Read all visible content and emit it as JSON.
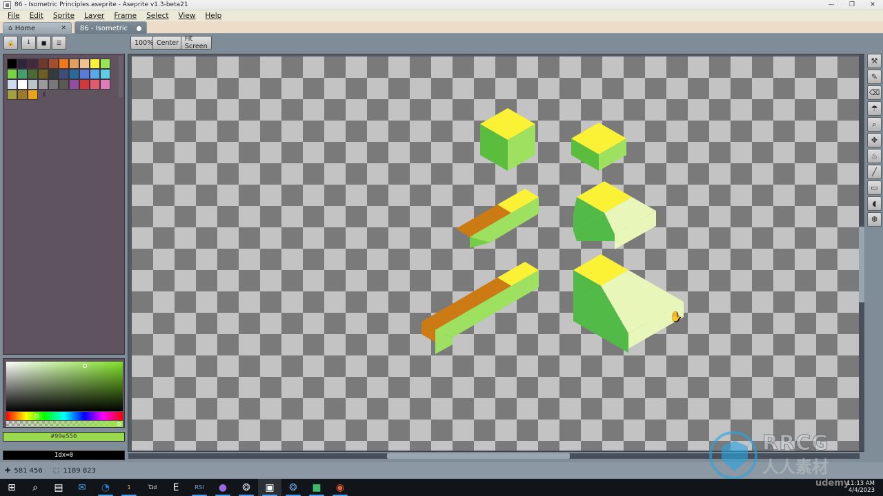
{
  "window": {
    "title": "86 - Isometric Principles.aseprite - Aseprite v1.3-beta21",
    "minimize_label": "—",
    "maximize_label": "❐",
    "close_label": "✕"
  },
  "menubar": {
    "items": [
      {
        "label": "File"
      },
      {
        "label": "Edit"
      },
      {
        "label": "Sprite"
      },
      {
        "label": "Layer"
      },
      {
        "label": "Frame"
      },
      {
        "label": "Select"
      },
      {
        "label": "View"
      },
      {
        "label": "Help"
      }
    ]
  },
  "tabs": [
    {
      "label": "Home",
      "icon": "home-icon",
      "close_label": "✕",
      "active": false
    },
    {
      "label": "86 - Isometric",
      "icon": "modified-dot",
      "active": true
    }
  ],
  "toolbar": {
    "lock_label": "🔒",
    "download_label": "↓",
    "square_label": "■",
    "menu_label": "☰",
    "zoom_label": "100%",
    "center_label": "Center",
    "fit_screen_label": "Fit Screen"
  },
  "palette": {
    "row1": [
      "#000000",
      "#2e2638",
      "#44293a",
      "#6f3a2c",
      "#a5502a",
      "#f07818",
      "#e0a060",
      "#eec392",
      "#fbf236",
      "#99e550"
    ],
    "row2": [
      "#77d442",
      "#44a06a",
      "#4a6b32",
      "#6b6020",
      "#353b38",
      "#3f4d7a",
      "#2a6a96",
      "#5b7ad8",
      "#5aa8ea",
      "#5fcde4"
    ],
    "row3": [
      "#cfdcef",
      "#ffffff",
      "#b9c6c8",
      "#9a9a9a",
      "#787878",
      "#5a5a52",
      "#8f4fa0",
      "#d43838",
      "#e35a6d",
      "#e07ab8"
    ],
    "row4": [
      "#a5a040",
      "#9b7a2a",
      "#e8a317"
    ],
    "marker": "II"
  },
  "colorpicker": {
    "hex_value": "#99e550",
    "index_value": "Idx=0",
    "accent": "#99e550"
  },
  "tools": [
    {
      "name": "magic-wand-icon",
      "glyph": "⚒",
      "selected": false
    },
    {
      "name": "pencil-icon",
      "glyph": "✎",
      "selected": false
    },
    {
      "name": "eraser-icon",
      "glyph": "⌫",
      "selected": false
    },
    {
      "name": "eyedropper-icon",
      "glyph": "☂",
      "selected": false
    },
    {
      "name": "zoom-icon",
      "glyph": "⌕",
      "selected": false
    },
    {
      "name": "move-icon",
      "glyph": "✥",
      "selected": false
    },
    {
      "name": "paint-bucket-icon",
      "glyph": "♨",
      "selected": false
    },
    {
      "name": "line-icon",
      "glyph": "╱",
      "selected": false
    },
    {
      "name": "rectangle-icon",
      "glyph": "▭",
      "selected": false
    },
    {
      "name": "contour-icon",
      "glyph": "◖",
      "selected": false
    },
    {
      "name": "spray-icon",
      "glyph": "❆",
      "selected": false
    }
  ],
  "statusbar": {
    "cursor_icon": "✚",
    "cursor_pos": "581 456",
    "size_icon": "⬚",
    "sprite_size": "1189 823"
  },
  "canvas": {
    "cursor": "hand-cursor",
    "shapes": [
      {
        "name": "cube-tall",
        "type": "isometric-cube"
      },
      {
        "name": "cube-short",
        "type": "isometric-slab"
      },
      {
        "name": "ramp-left-small",
        "type": "isometric-ramp"
      },
      {
        "name": "ramp-right-small",
        "type": "isometric-ramp"
      },
      {
        "name": "ramp-left-large",
        "type": "isometric-ramp"
      },
      {
        "name": "ramp-right-large",
        "type": "isometric-ramp"
      }
    ],
    "colors": {
      "top_yellow": "#fbf236",
      "side_green_dark": "#5bbd3e",
      "side_green_light": "#9ee05f",
      "slope_orange": "#cc7a14",
      "slope_pale": "#e8f7b9",
      "slope_green": "#52bb47"
    }
  },
  "taskbar": {
    "items": [
      {
        "name": "start-button",
        "glyph": "⊞"
      },
      {
        "name": "search-icon",
        "glyph": "⌕"
      },
      {
        "name": "task-view-icon",
        "glyph": "▤"
      },
      {
        "name": "mail-icon",
        "glyph": "✉"
      },
      {
        "name": "edge-icon",
        "glyph": "◔"
      },
      {
        "name": "file-explorer-icon",
        "glyph": "὜1"
      },
      {
        "name": "store-icon",
        "glyph": "Ὤd"
      },
      {
        "name": "epic-games-icon",
        "glyph": "E"
      },
      {
        "name": "rsi-launcher-icon",
        "glyph": "RSI"
      },
      {
        "name": "media-player-icon",
        "glyph": "●"
      },
      {
        "name": "steam-icon",
        "glyph": "❂"
      },
      {
        "name": "aseprite-icon",
        "glyph": "▣"
      },
      {
        "name": "blender-icon",
        "glyph": "❂"
      },
      {
        "name": "app-green-icon",
        "glyph": "■"
      },
      {
        "name": "chrome-icon",
        "glyph": "◉"
      }
    ]
  },
  "clock": {
    "time": "11:13 AM",
    "date": "4/4/2023"
  },
  "watermark": {
    "brand": "RRCG",
    "chinese": "人人素材",
    "udemy": "udemy"
  }
}
